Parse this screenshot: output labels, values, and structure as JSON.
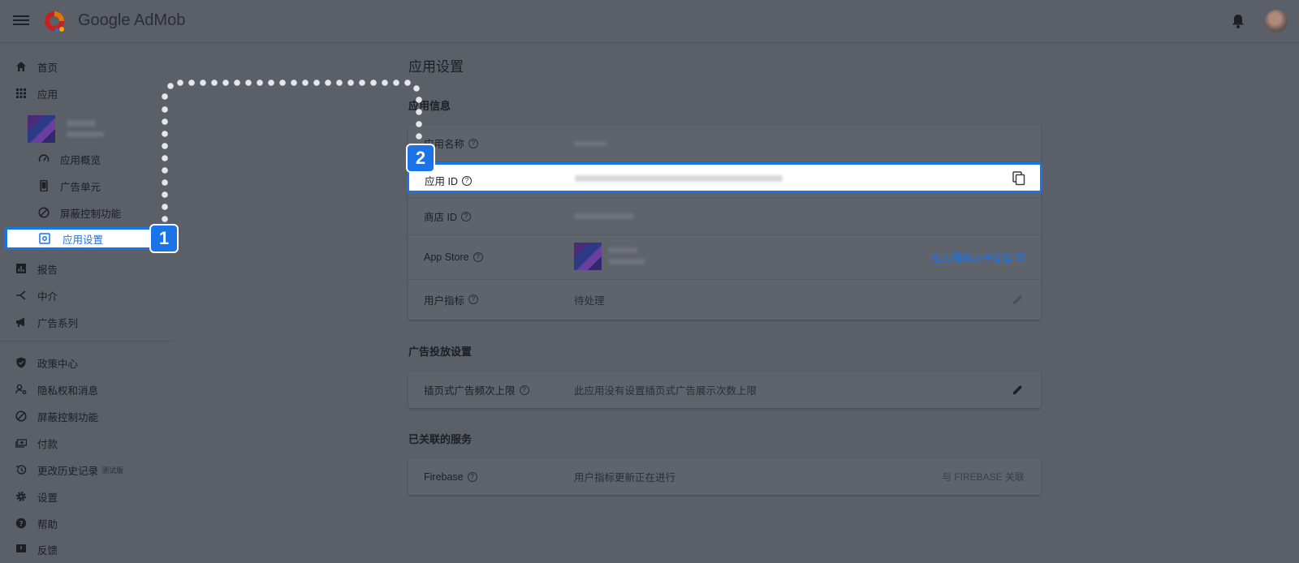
{
  "header": {
    "brand": "Google AdMob",
    "menu_icon": "hamburger-menu-icon",
    "logo_icon": "admob-logo-icon",
    "notifications_icon": "bell-icon"
  },
  "sidebar": {
    "home": "首页",
    "apps": "应用",
    "app_sub_items": {
      "overview": "应用概览",
      "ad_units": "广告单元",
      "blocking_controls": "屏蔽控制功能",
      "app_settings": "应用设置"
    },
    "reports": "报告",
    "mediation": "中介",
    "campaigns": "广告系列",
    "policy_center": "政策中心",
    "privacy_messaging": "隐私权和消息",
    "blocking_controls": "屏蔽控制功能",
    "payments": "付款",
    "change_history": "更改历史记录",
    "change_history_badge": "测试版",
    "settings": "设置",
    "help": "帮助",
    "feedback": "反馈"
  },
  "main": {
    "page_title": "应用设置",
    "app_info": {
      "section_title": "应用信息",
      "app_name_label": "应用名称",
      "app_id_label": "应用 ID",
      "store_id_label": "商店 ID",
      "app_store_label": "App Store",
      "app_store_link": "在应用商店中查看",
      "user_metrics_label": "用户指标",
      "user_metrics_value": "待处理"
    },
    "ad_serving": {
      "section_title": "广告投放设置",
      "frequency_cap_label": "插页式广告频次上限",
      "frequency_cap_value": "此应用没有设置插页式广告展示次数上限"
    },
    "linked_services": {
      "section_title": "已关联的服务",
      "firebase_label": "Firebase",
      "firebase_value": "用户指标更新正在进行",
      "firebase_link": "与 FIREBASE 关联"
    }
  },
  "callouts": {
    "step1": "1",
    "step2": "2"
  },
  "colors": {
    "accent": "#1a73e8",
    "overlay_bg": "#5b5f67",
    "highlight_bg": "#ffffff"
  }
}
